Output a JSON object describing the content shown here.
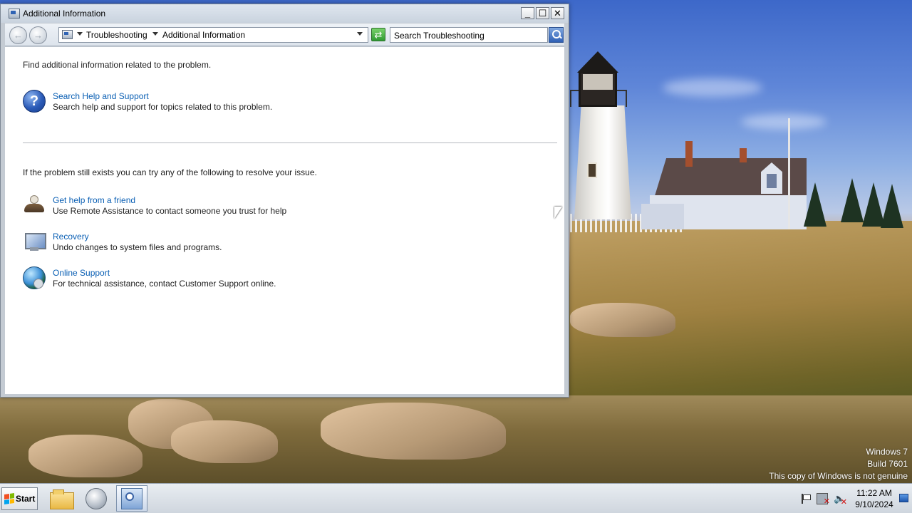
{
  "window": {
    "title": "Additional Information",
    "controls": {
      "minimize": "_",
      "maximize": "☐",
      "close": "✕"
    }
  },
  "navigation": {
    "back_icon": "back-arrow-icon",
    "forward_icon": "forward-arrow-icon",
    "breadcrumb": [
      "Troubleshooting",
      "Additional Information"
    ],
    "search_placeholder": "Search Troubleshooting"
  },
  "content": {
    "intro": "Find additional information related to the problem.",
    "help_item": {
      "link": "Search Help and Support",
      "description": "Search help and support for topics related to this problem."
    },
    "intro2": "If the problem still exists you can try any of the following to resolve your issue.",
    "options": [
      {
        "link": "Get help from a friend",
        "description": "Use Remote Assistance to contact someone you trust for help",
        "icon": "remote-assistance-icon"
      },
      {
        "link": "Recovery",
        "description": "Undo changes to system files and programs.",
        "icon": "recovery-icon"
      },
      {
        "link": "Online Support",
        "description": "For technical assistance, contact Customer Support online.",
        "icon": "online-support-icon"
      }
    ]
  },
  "watermark": {
    "line1": "Windows 7",
    "line2": "Build 7601",
    "line3": "This copy of Windows is not genuine"
  },
  "taskbar": {
    "start_label": "Start",
    "pinned": [
      "windows-explorer",
      "windows-media-player",
      "troubleshooting"
    ],
    "clock_time": "11:22 AM",
    "clock_date": "9/10/2024"
  },
  "colors": {
    "link": "#0a5fb4",
    "text": "#1e1e1e",
    "window_frame": "#c4cbd3"
  }
}
